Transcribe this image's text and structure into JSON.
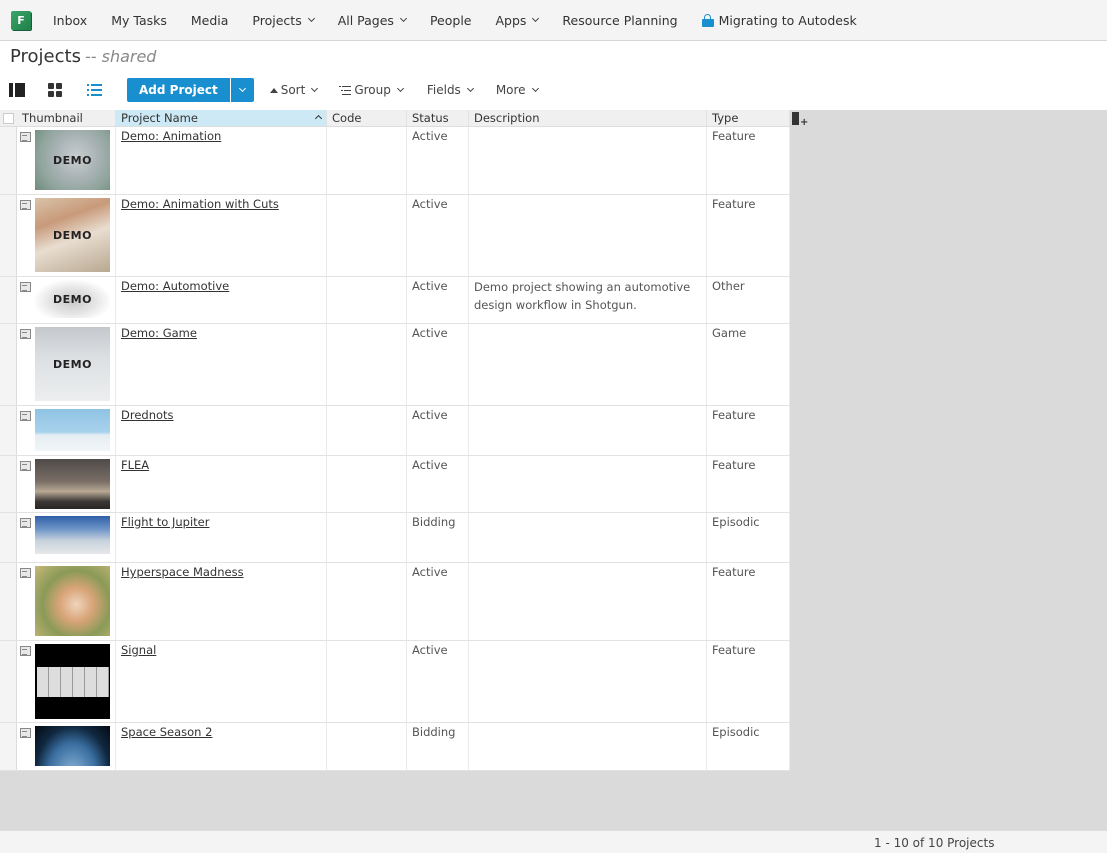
{
  "nav": {
    "logo_letter": "F",
    "items": [
      {
        "label": "Inbox",
        "dropdown": false
      },
      {
        "label": "My Tasks",
        "dropdown": false
      },
      {
        "label": "Media",
        "dropdown": false
      },
      {
        "label": "Projects",
        "dropdown": true
      },
      {
        "label": "All Pages",
        "dropdown": true
      },
      {
        "label": "People",
        "dropdown": false
      },
      {
        "label": "Apps",
        "dropdown": true
      },
      {
        "label": "Resource Planning",
        "dropdown": false
      }
    ],
    "migrating": {
      "label": "Migrating to Autodesk",
      "icon": "lock-icon"
    }
  },
  "page": {
    "title": "Projects",
    "subtitle": "-- shared"
  },
  "toolbar": {
    "view_modes": [
      "detail-view-icon",
      "thumbnail-grid-icon",
      "list-view-icon"
    ],
    "add_label": "Add Project",
    "sort_label": "Sort",
    "group_label": "Group",
    "fields_label": "Fields",
    "more_label": "More"
  },
  "colors": {
    "accent": "#1a8fd0",
    "logo_green": "#2a9a5c",
    "sorted_header": "#cde9f5",
    "background_gray": "#dadada"
  },
  "table": {
    "columns": [
      "Thumbnail",
      "Project Name",
      "Code",
      "Status",
      "Description",
      "Type"
    ],
    "sorted_column": "Project Name",
    "sort_direction": "ascending",
    "rows": [
      {
        "name": "Demo: Animation",
        "code": "",
        "status": "Active",
        "description": "",
        "type": "Feature",
        "thumb_label": "DEMO",
        "thumb": "animation"
      },
      {
        "name": "Demo: Animation with Cuts",
        "code": "",
        "status": "Active",
        "description": "",
        "type": "Feature",
        "thumb_label": "DEMO",
        "thumb": "cuts"
      },
      {
        "name": "Demo: Automotive",
        "code": "",
        "status": "Active",
        "description": "Demo project showing an automotive design workflow in Shotgun.",
        "type": "Other",
        "thumb_label": "DEMO",
        "thumb": "auto"
      },
      {
        "name": "Demo: Game",
        "code": "",
        "status": "Active",
        "description": "",
        "type": "Game",
        "thumb_label": "DEMO",
        "thumb": "game"
      },
      {
        "name": "Drednots",
        "code": "",
        "status": "Active",
        "description": "",
        "type": "Feature",
        "thumb_label": "",
        "thumb": "drednots"
      },
      {
        "name": "FLEA",
        "code": "",
        "status": "Active",
        "description": "",
        "type": "Feature",
        "thumb_label": "",
        "thumb": "flea"
      },
      {
        "name": "Flight to Jupiter",
        "code": "",
        "status": "Bidding",
        "description": "",
        "type": "Episodic",
        "thumb_label": "",
        "thumb": "flight"
      },
      {
        "name": "Hyperspace Madness",
        "code": "",
        "status": "Active",
        "description": "",
        "type": "Feature",
        "thumb_label": "",
        "thumb": "hyper"
      },
      {
        "name": "Signal",
        "code": "",
        "status": "Active",
        "description": "",
        "type": "Feature",
        "thumb_label": "",
        "thumb": "signal"
      },
      {
        "name": "Space Season 2",
        "code": "",
        "status": "Bidding",
        "description": "",
        "type": "Episodic",
        "thumb_label": "",
        "thumb": "space"
      }
    ]
  },
  "footer": {
    "count_text": "1 - 10 of 10 Projects"
  }
}
